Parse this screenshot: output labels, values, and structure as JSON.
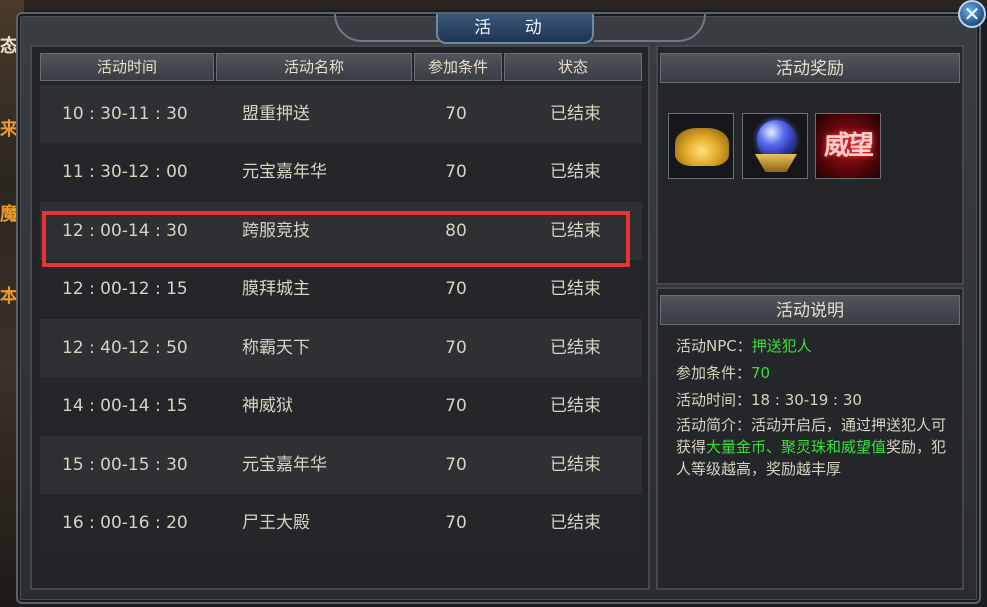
{
  "window": {
    "title": "活 动",
    "close_glyph": "✕"
  },
  "table": {
    "headers": [
      "活动时间",
      "活动名称",
      "参加条件",
      "状态"
    ],
    "rows": [
      {
        "time": "10 : 30-11 : 30",
        "name": "盟重押送",
        "level": "70",
        "status": "已结束"
      },
      {
        "time": "11 : 30-12 : 00",
        "name": "元宝嘉年华",
        "level": "70",
        "status": "已结束"
      },
      {
        "time": "12 : 00-14 : 30",
        "name": "跨服竞技",
        "level": "80",
        "status": "已结束"
      },
      {
        "time": "12 : 00-12 : 15",
        "name": "膜拜城主",
        "level": "70",
        "status": "已结束"
      },
      {
        "time": "12 : 40-12 : 50",
        "name": "称霸天下",
        "level": "70",
        "status": "已结束"
      },
      {
        "time": "14 : 00-14 : 15",
        "name": "神威狱",
        "level": "70",
        "status": "已结束"
      },
      {
        "time": "15 : 00-15 : 30",
        "name": "元宝嘉年华",
        "level": "70",
        "status": "已结束"
      },
      {
        "time": "16 : 00-16 : 20",
        "name": "尸王大殿",
        "level": "70",
        "status": "已结束"
      }
    ],
    "selected_index": 2,
    "highlight_color": "#e5343a"
  },
  "rewards": {
    "header": "活动奖励",
    "items": [
      {
        "icon": "gold-coins-icon"
      },
      {
        "icon": "spirit-orb-icon"
      },
      {
        "icon": "prestige-icon",
        "text": "威望"
      }
    ]
  },
  "description": {
    "header": "活动说明",
    "npc_label": "活动NPC：",
    "npc_value": "押送犯人",
    "cond_label": "参加条件：",
    "cond_value": "70",
    "time_label": "活动时间：",
    "time_value": "18 : 30-19 : 30",
    "intro_a": "活动简介：活动开启后，通过押送犯人可获得",
    "intro_b": "大量金币、聚灵珠和威望值",
    "intro_c": "奖励，犯人等级越高，奖励越丰厚",
    "accent_green": "#36e23a"
  },
  "background": {
    "side_glyphs": [
      "态",
      "来",
      "魔",
      "本"
    ]
  }
}
